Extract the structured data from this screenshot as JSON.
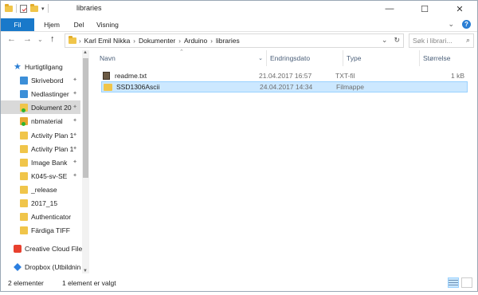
{
  "window": {
    "title": "libraries",
    "controls": {
      "minimize": "—",
      "maximize": "☐",
      "close": "✕"
    }
  },
  "ribbon": {
    "tabs": [
      "Fil",
      "Hjem",
      "Del",
      "Visning"
    ]
  },
  "address": {
    "breadcrumbs": [
      "Karl Emil Nikka",
      "Dokumenter",
      "Arduino",
      "libraries"
    ],
    "search_placeholder": "Søk i librari..."
  },
  "nav": {
    "items": [
      {
        "label": "Hurtigtilgang",
        "icon": "star-icon",
        "pinned": false
      },
      {
        "label": "Skrivebord",
        "icon": "desktop-icon",
        "pinned": true
      },
      {
        "label": "Nedlastinger",
        "icon": "download-icon",
        "pinned": true
      },
      {
        "label": "Dokument 20",
        "icon": "documents-icon",
        "pinned": true,
        "selected": true
      },
      {
        "label": "nbmaterial",
        "icon": "shared-folder-icon",
        "pinned": true
      },
      {
        "label": "Activity Plan 1",
        "icon": "folder-icon",
        "pinned": true
      },
      {
        "label": "Activity Plan 1",
        "icon": "folder-icon",
        "pinned": true
      },
      {
        "label": "Image Bank",
        "icon": "folder-icon",
        "pinned": true
      },
      {
        "label": "K045-sv-SE",
        "icon": "folder-icon",
        "pinned": true
      },
      {
        "label": "_release",
        "icon": "folder-icon",
        "pinned": false
      },
      {
        "label": "2017_15",
        "icon": "folder-icon",
        "pinned": false
      },
      {
        "label": "Authenticator",
        "icon": "folder-icon",
        "pinned": false
      },
      {
        "label": "Färdiga TIFF",
        "icon": "folder-icon",
        "pinned": false
      },
      {
        "label": "Creative Cloud File",
        "icon": "creative-cloud-icon",
        "pinned": false
      },
      {
        "label": "Dropbox (Utbildnin",
        "icon": "dropbox-icon",
        "pinned": false
      }
    ]
  },
  "columns": {
    "name": "Navn",
    "date": "Endringsdato",
    "type": "Type",
    "size": "Størrelse"
  },
  "files": [
    {
      "name": "readme.txt",
      "date": "21.04.2017 16:57",
      "type": "TXT-fil",
      "size": "1 kB",
      "icon": "text-file-icon",
      "selected": false
    },
    {
      "name": "SSD1306Ascii",
      "date": "24.04.2017 14:34",
      "type": "Filmappe",
      "size": "",
      "icon": "folder-icon",
      "selected": true
    }
  ],
  "status": {
    "count": "2 elementer",
    "selection": "1 element er valgt"
  },
  "colors": {
    "accent": "#1979ca",
    "selection_bg": "#cce8ff",
    "selection_border": "#99d1ff",
    "folder": "#f0c54a"
  }
}
